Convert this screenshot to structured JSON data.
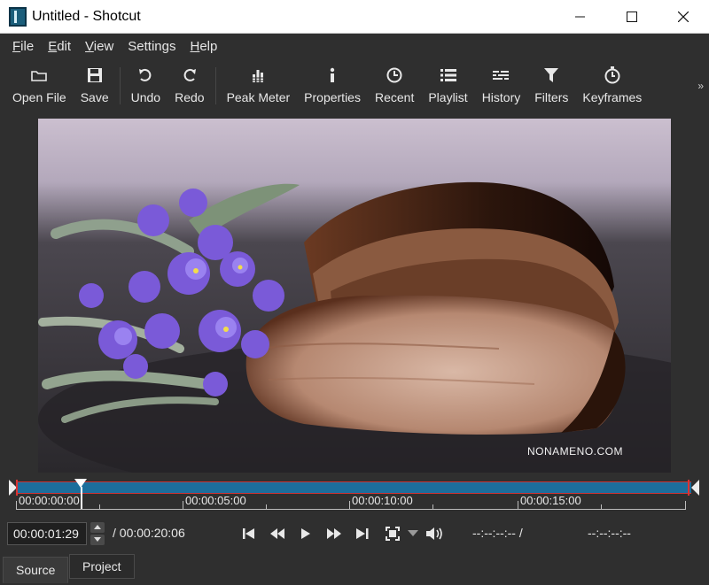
{
  "window": {
    "title": "Untitled - Shotcut"
  },
  "menu": [
    {
      "label": "File",
      "key": "F",
      "rest": "ile"
    },
    {
      "label": "Edit",
      "key": "E",
      "rest": "dit"
    },
    {
      "label": "View",
      "key": "V",
      "rest": "iew"
    },
    {
      "label": "Settings",
      "key": "",
      "rest": "Settings"
    },
    {
      "label": "Help",
      "key": "H",
      "rest": "elp"
    }
  ],
  "toolbar": {
    "open_file": "Open File",
    "save": "Save",
    "undo": "Undo",
    "redo": "Redo",
    "peak_meter": "Peak Meter",
    "properties": "Properties",
    "recent": "Recent",
    "playlist": "Playlist",
    "history": "History",
    "filters": "Filters",
    "keyframes": "Keyframes",
    "more": "»"
  },
  "preview": {
    "watermark": "NONAMENO.COM"
  },
  "timeline": {
    "ticks": [
      "00:00:00:00",
      "00:00:05:00",
      "00:00:10:00",
      "00:00:15:00"
    ]
  },
  "transport": {
    "position": "00:00:01:29",
    "duration": "/ 00:00:20:06",
    "in_point": "--:--:--:-- /",
    "out_point": "--:--:--:--"
  },
  "tabs": {
    "source": "Source",
    "project": "Project"
  },
  "colors": {
    "accent": "#1c6e9c",
    "playhead_marker": "#d33333",
    "background": "#2f2f2f"
  }
}
